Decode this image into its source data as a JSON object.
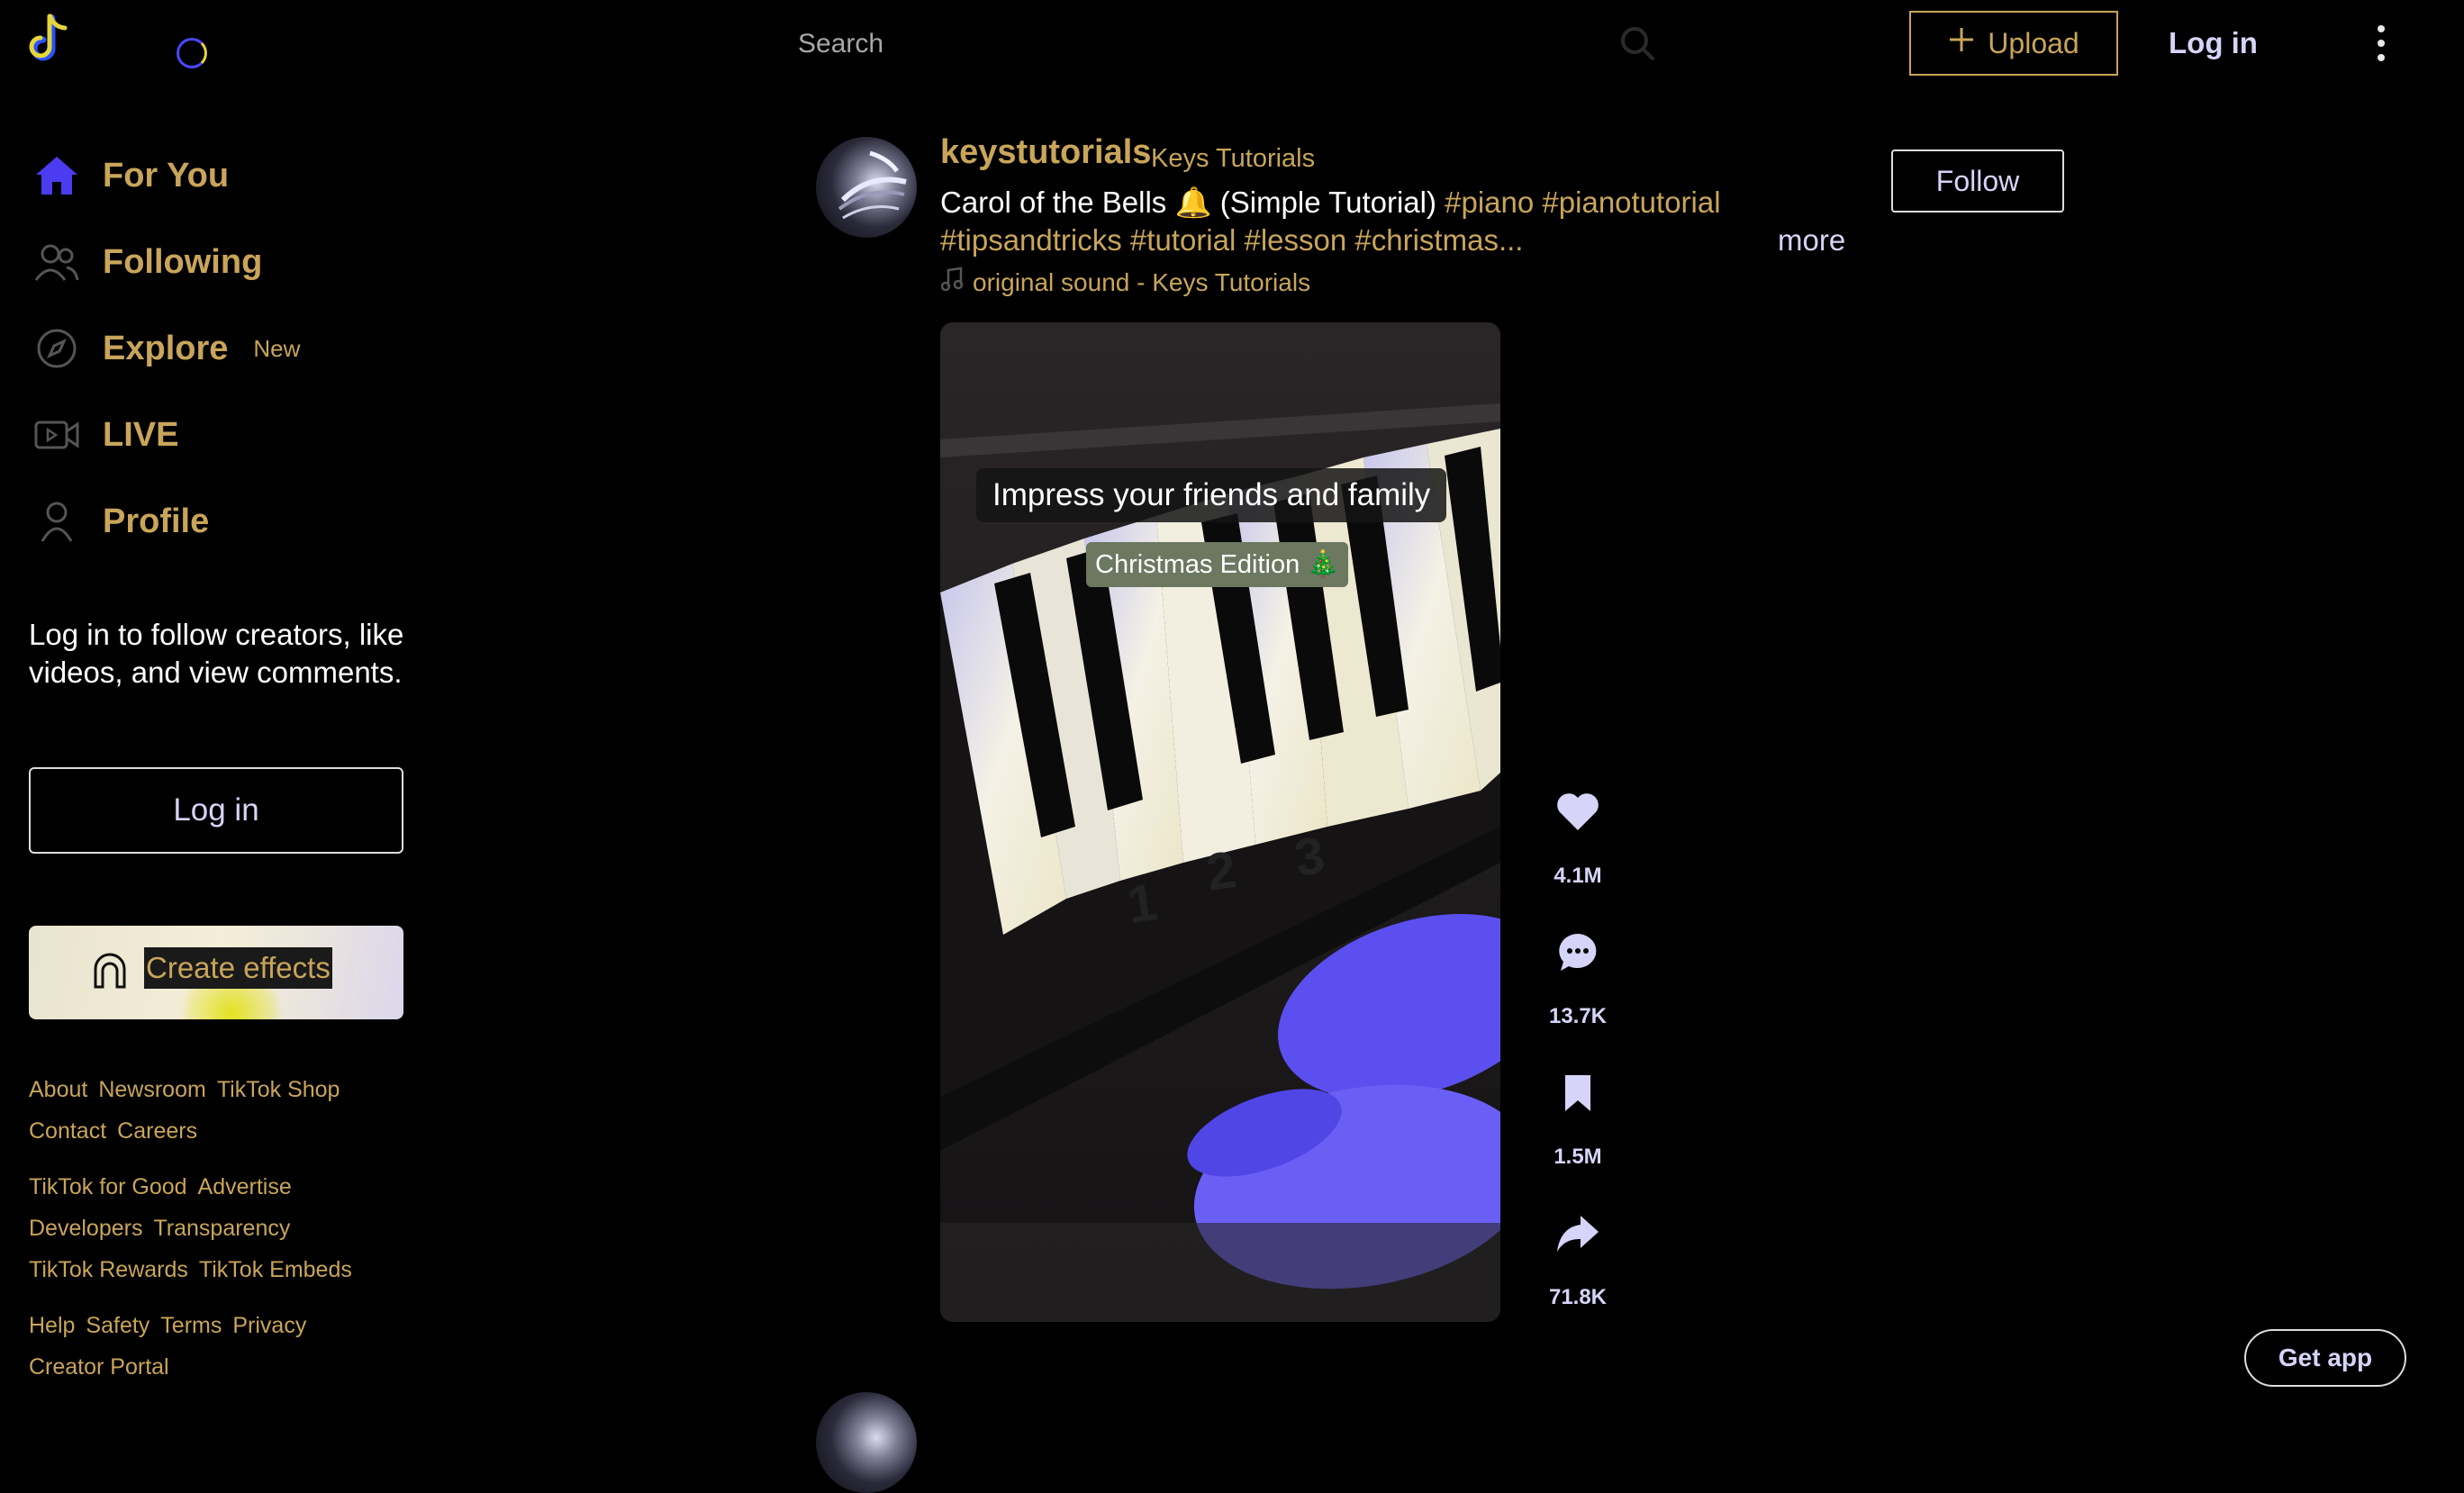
{
  "header": {
    "search_placeholder": "Search",
    "upload_label": "Upload",
    "login_label": "Log in"
  },
  "sidebar": {
    "items": [
      {
        "label": "For You",
        "icon": "home-icon"
      },
      {
        "label": "Following",
        "icon": "following-icon"
      },
      {
        "label": "Explore",
        "icon": "compass-icon",
        "badge": "New"
      },
      {
        "label": "LIVE",
        "icon": "live-icon"
      },
      {
        "label": "Profile",
        "icon": "profile-icon"
      }
    ],
    "login_prompt": "Log in to follow creators, like videos, and view comments.",
    "login_button": "Log in",
    "create_effects": "Create effects",
    "footer_links": [
      [
        "About",
        "Newsroom",
        "TikTok Shop"
      ],
      [
        "Contact",
        "Careers"
      ],
      [
        "TikTok for Good",
        "Advertise"
      ],
      [
        "Developers",
        "Transparency"
      ],
      [
        "TikTok Rewards",
        "TikTok Embeds"
      ],
      [
        "Help",
        "Safety",
        "Terms",
        "Privacy"
      ],
      [
        "Creator Portal"
      ]
    ]
  },
  "post": {
    "username": "keystutorials",
    "display_name": "Keys Tutorials",
    "caption_text": "Carol of the Bells",
    "caption_emoji": "🔔",
    "caption_rest": "(Simple Tutorial)",
    "hashtags_line1": [
      "#piano",
      "#pianotutorial"
    ],
    "hashtags_line2": "#tipsandtricks #tutorial #lesson #christmas...",
    "more_label": "more",
    "sound": "original sound - Keys Tutorials",
    "follow_label": "Follow",
    "video": {
      "overlay_title": "Impress your friends and family",
      "overlay_subtitle": "Christmas Edition 🎄",
      "key_numbers": [
        "1",
        "2",
        "3"
      ]
    },
    "actions": {
      "likes": "4.1M",
      "comments": "13.7K",
      "saves": "1.5M",
      "shares": "71.8K"
    }
  },
  "get_app_label": "Get app",
  "colors": {
    "background": "#000000",
    "accent_gold": "#c9a55a",
    "accent_lavender": "#d6d4f8",
    "home_active": "#4b3cf0"
  }
}
